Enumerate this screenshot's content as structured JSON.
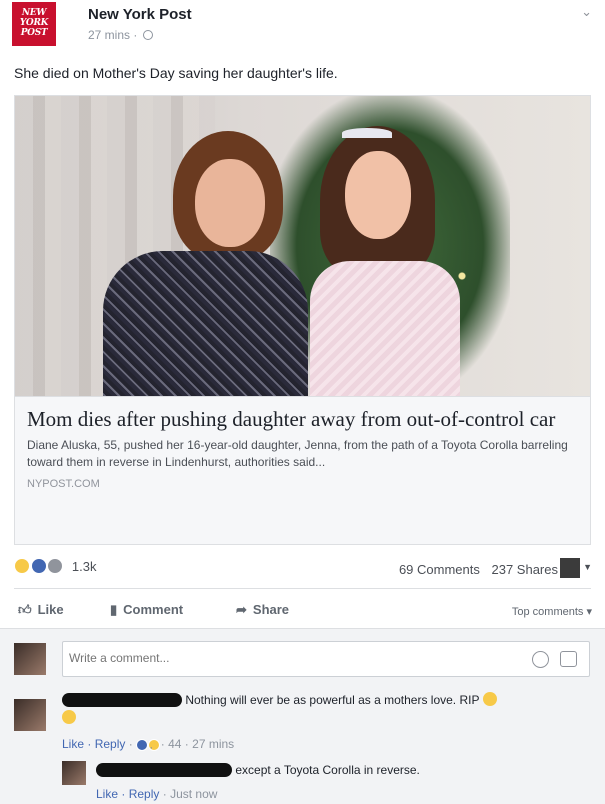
{
  "post": {
    "page_name": "New York Post",
    "logo_text": "NEW YORK POST",
    "time": "27 mins",
    "caption": "She died on Mother's Day saving her daughter's life.",
    "menu_icon": "chevron-down-icon"
  },
  "link": {
    "title": "Mom dies after pushing daughter away from out-of-control car",
    "description": "Diane Aluska, 55, pushed her 16-year-old daughter, Jenna, from the path of a Toyota Corolla barreling toward them in reverse in Lindenhurst, authorities said...",
    "domain": "NYPOST.COM"
  },
  "stats": {
    "reactions": "1.3k",
    "comments": "69 Comments",
    "shares": "237 Shares"
  },
  "actions": {
    "like": "Like",
    "comment": "Comment",
    "share": "Share",
    "sort": "Top comments"
  },
  "compose": {
    "placeholder": "Write a comment..."
  },
  "comments": [
    {
      "text": "Nothing will ever be as powerful as a mothers love. RIP",
      "like": "Like",
      "reply": "Reply",
      "reaction_count": "44",
      "time": "27 mins"
    },
    {
      "text": "except a Toyota Corolla in reverse.",
      "like": "Like",
      "reply": "Reply",
      "time": "Just now"
    }
  ],
  "colors": {
    "link_blue": "#4267b2",
    "muted": "#90949c",
    "brand_red": "#c8102e"
  }
}
